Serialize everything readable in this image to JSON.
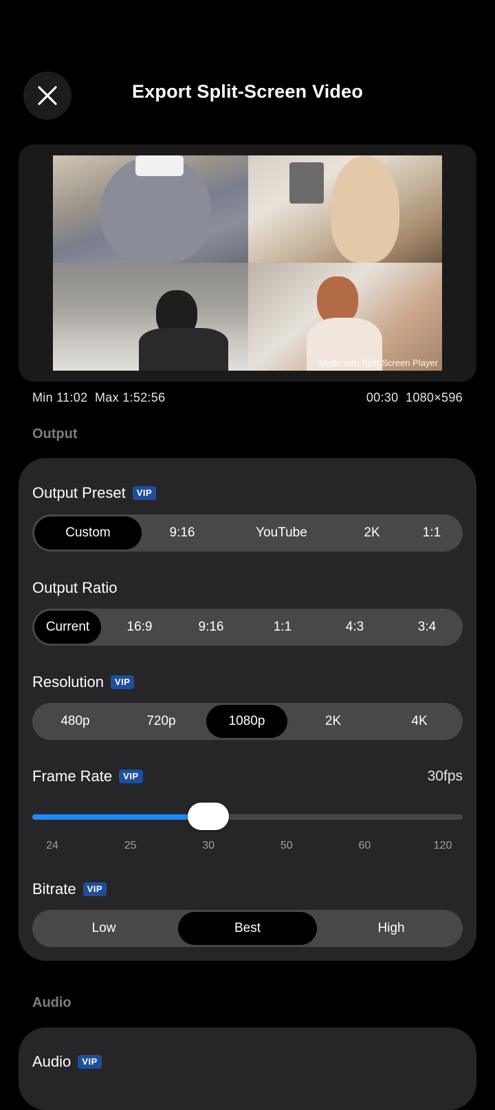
{
  "header": {
    "title": "Export Split-Screen Video"
  },
  "preview": {
    "watermark": "Made with Split Screen Player",
    "min_max": "Min 11:02  Max 1:52:56",
    "duration_size": "00:30  1080×596"
  },
  "sections": {
    "output": "Output",
    "audio": "Audio"
  },
  "output_preset": {
    "label": "Output Preset",
    "vip": "VIP",
    "options": [
      "Custom",
      "9:16",
      "YouTube",
      "2K",
      "1:1"
    ],
    "selected": "Custom"
  },
  "output_ratio": {
    "label": "Output Ratio",
    "options": [
      "Current",
      "16:9",
      "9:16",
      "1:1",
      "4:3",
      "3:4"
    ],
    "selected": "Current"
  },
  "resolution": {
    "label": "Resolution",
    "vip": "VIP",
    "options": [
      "480p",
      "720p",
      "1080p",
      "2K",
      "4K"
    ],
    "selected": "1080p"
  },
  "frame_rate": {
    "label": "Frame Rate",
    "vip": "VIP",
    "value_label": "30fps",
    "ticks": [
      "24",
      "25",
      "30",
      "50",
      "60",
      "120"
    ],
    "selected_index": 2
  },
  "bitrate": {
    "label": "Bitrate",
    "vip": "VIP",
    "options": [
      "Low",
      "Best",
      "High"
    ],
    "selected": "Best"
  },
  "audio": {
    "label": "Audio",
    "vip": "VIP"
  },
  "colors": {
    "accent": "#1f87ff",
    "vip_badge": "#1e4f9c",
    "card": "#262628",
    "segment": "#48484a"
  }
}
